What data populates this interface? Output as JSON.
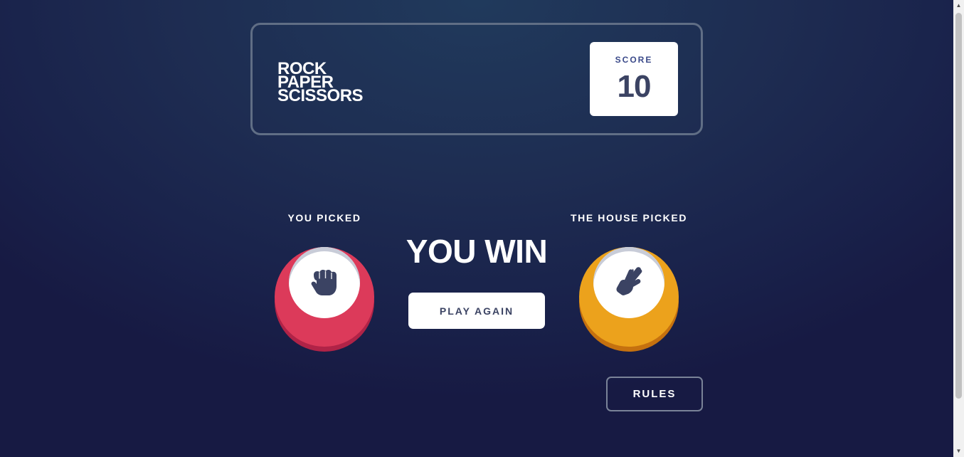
{
  "header": {
    "title_lines": [
      "ROCK",
      "PAPER",
      "SCISSORS"
    ],
    "score_label": "SCORE",
    "score_value": "10"
  },
  "game": {
    "player_label": "YOU PICKED",
    "house_label": "THE HOUSE PICKED",
    "player_choice": "rock",
    "house_choice": "scissors",
    "result_text": "YOU WIN",
    "play_again_label": "PLAY AGAIN"
  },
  "footer": {
    "rules_label": "RULES"
  },
  "colors": {
    "rock": "#dc3a5a",
    "scissors": "#eca21c",
    "dark_text": "#3b4363",
    "header_outline": "#606e85"
  },
  "icons": {
    "player_icon": "rock-fist-icon",
    "house_icon": "scissors-hand-icon"
  }
}
